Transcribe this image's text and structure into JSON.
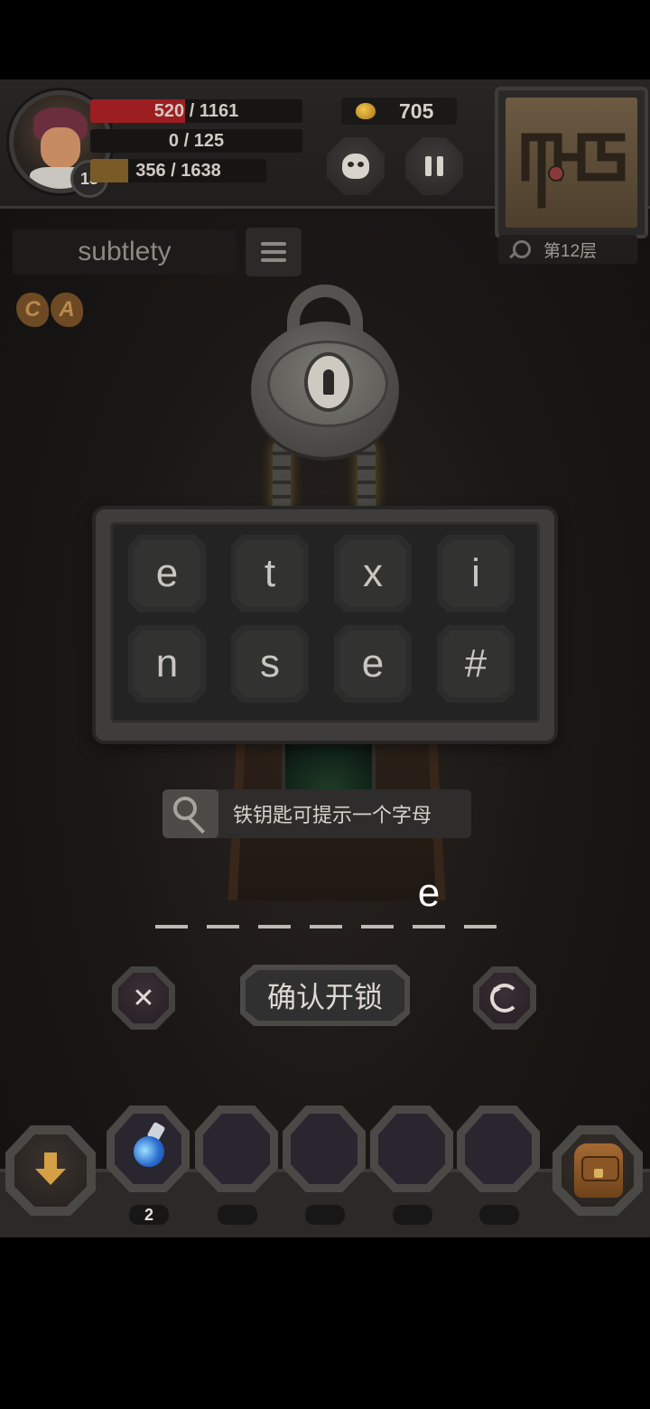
{
  "hud": {
    "level": "13",
    "hp": {
      "text": "520 / 1161",
      "fraction": 0.448
    },
    "mp": {
      "text": "0 / 125",
      "fraction": 0.0
    },
    "xp": {
      "text": "356 / 1638",
      "fraction": 0.217
    },
    "gold": "705",
    "floor_label": "第12层"
  },
  "puzzle": {
    "word": "subtlety",
    "letters": [
      "e",
      "t",
      "x",
      "i",
      "n",
      "s",
      "e",
      "#"
    ],
    "hint_text": "铁钥匙可提示一个字母",
    "answer_slots": [
      "",
      "",
      "",
      "",
      "",
      "e",
      ""
    ],
    "confirm_label": "确认开锁",
    "clear_label": "✕"
  },
  "tokens": [
    "C",
    "A"
  ],
  "inventory": {
    "slots": [
      {
        "item": "potion-icon",
        "count": "2"
      },
      {
        "item": "",
        "count": ""
      },
      {
        "item": "",
        "count": ""
      },
      {
        "item": "",
        "count": ""
      },
      {
        "item": "",
        "count": ""
      }
    ]
  },
  "colors": {
    "hp_fill": "#9c1e21",
    "xp_fill": "#7a5a27",
    "gold": "#d4a043"
  }
}
